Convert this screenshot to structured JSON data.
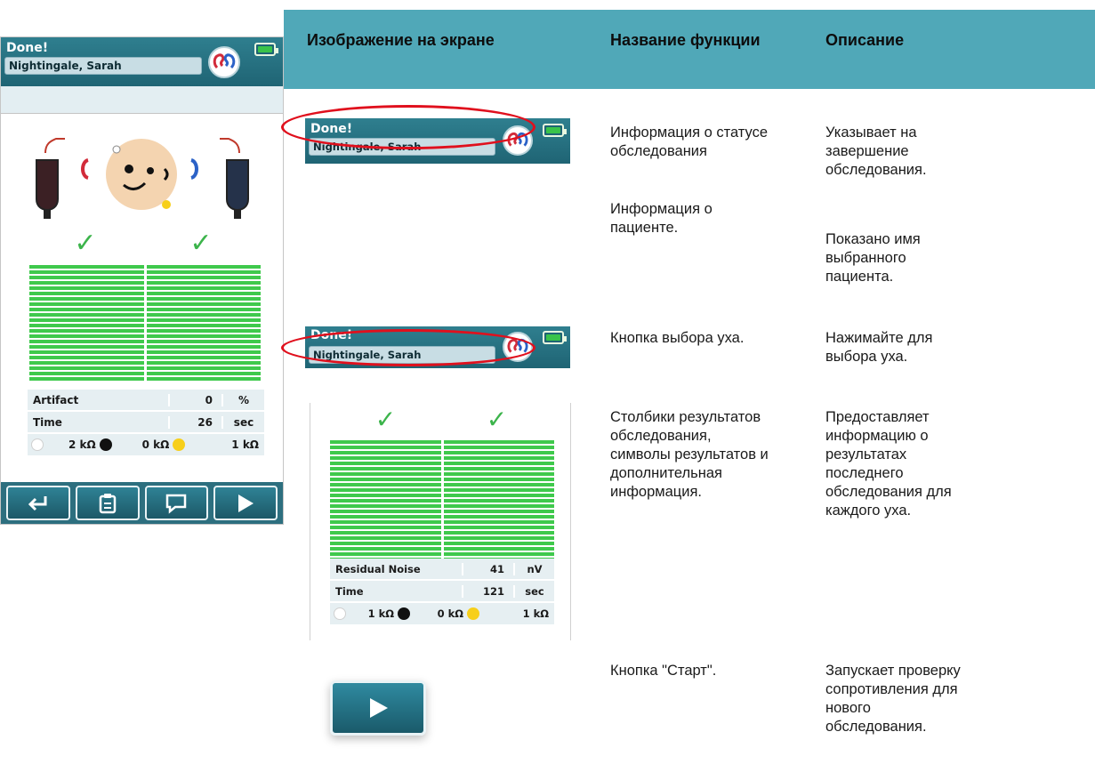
{
  "device": {
    "status": "Done!",
    "patient": "Nightingale, Sarah",
    "checks": [
      "✓",
      "✓"
    ],
    "table": {
      "rows": [
        {
          "label": "Artifact",
          "value": "0",
          "unit": "%"
        },
        {
          "label": "Time",
          "value": "26",
          "unit": "sec"
        }
      ],
      "impedance": [
        "2 kΩ",
        "0 kΩ",
        "1 kΩ"
      ]
    },
    "toolbar": {
      "back_icon": "return-icon",
      "report_icon": "clipboard-icon",
      "comment_icon": "speech-bubble-icon",
      "start_icon": "play-icon"
    },
    "bar_fill": [
      1.0,
      1.0
    ]
  },
  "table": {
    "headers": [
      "Изображение на экране",
      "Название функции",
      "Описание"
    ],
    "rows": [
      {
        "function": "Информация о статусе\nобследования",
        "function2": "Информация о\nпациенте.",
        "description": "Указывает на\nзавершение\nобследования.",
        "description2": "Показано имя\nвыбранного\nпациента."
      },
      {
        "function": "Кнопка выбора уха.",
        "description": "Нажимайте для\nвыбора уха."
      },
      {
        "function": "Столбики результатов\nобследования,\nсимволы результатов и\nдополнительная\nинформация.",
        "description": "Предоставляет\nинформацию о\nрезультатах\nпоследнего\nобследования для\nкаждого уха."
      },
      {
        "function": "Кнопка \"Старт\".",
        "description": "Запускает проверку\nсопротивления для\nнового\nобследования."
      }
    ]
  },
  "snippet_header": {
    "status": "Done!",
    "patient": "Nightingale, Sarah"
  },
  "result_snippet": {
    "checks": [
      "✓",
      "✓"
    ],
    "rows": [
      {
        "label": "Residual  Noise",
        "value": "41",
        "unit": "nV"
      },
      {
        "label": "Time",
        "value": "121",
        "unit": "sec"
      }
    ],
    "impedance": [
      "1 kΩ",
      "0 kΩ",
      "1 kΩ"
    ]
  },
  "colors": {
    "header_teal": "#1f6474",
    "table_head": "#50a8b8",
    "bar_green": "#3fc94c",
    "check_green": "#3cb44b",
    "highlight_red": "#e0101d"
  }
}
